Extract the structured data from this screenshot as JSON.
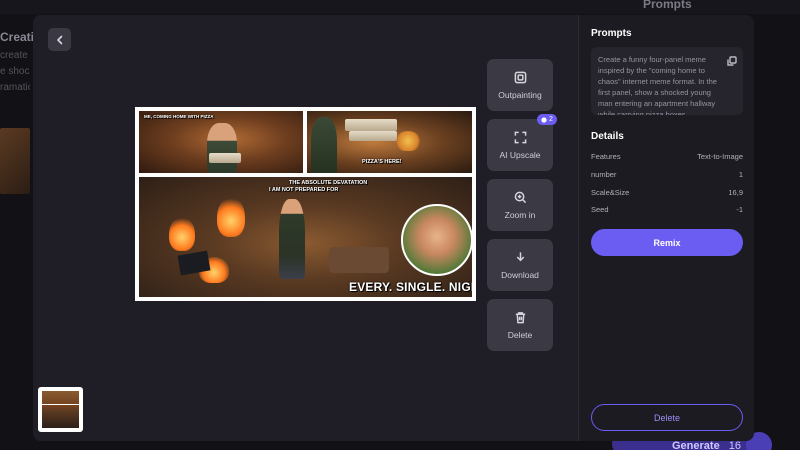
{
  "background": {
    "prompts_label": "Prompts",
    "left_title": "Creatio",
    "left_lines": [
      "create a",
      "e shock",
      "ramatic"
    ],
    "generate_label": "Generate",
    "generate_count": "16"
  },
  "viewer": {
    "meme": {
      "caption_panel1": "ME, COMING HOME WITH PIZZA",
      "caption_panel2": "PIZZA'S HERE!",
      "caption_panel3_line1": "THE ABSOLUTE DEVATATION",
      "caption_panel3_line2": "I AM NOT PREPARED FOR",
      "caption_big": "EVERY. SINGLE. NIGHT"
    },
    "actions": [
      {
        "label": "Outpainting",
        "icon": "outpainting-icon"
      },
      {
        "label": "AI Upscale",
        "icon": "upscale-icon",
        "badge": "2"
      },
      {
        "label": "Zoom in",
        "icon": "zoom-in-icon"
      },
      {
        "label": "Download",
        "icon": "download-icon"
      },
      {
        "label": "Delete",
        "icon": "trash-icon"
      }
    ]
  },
  "side_panel": {
    "prompts_title": "Prompts",
    "prompt_text": "Create a funny four-panel meme inspired by the \"coming home to chaos\" internet meme format. In the first panel, show a shocked young man entering an apartment hallway while carrying pizza boxes",
    "details_title": "Details",
    "details": [
      {
        "key": "Features",
        "value": "Text-to-Image"
      },
      {
        "key": "number",
        "value": "1"
      },
      {
        "key": "Scale&Size",
        "value": "16,9"
      },
      {
        "key": "Seed",
        "value": "-1"
      }
    ],
    "remix_label": "Remix",
    "delete_label": "Delete"
  },
  "colors": {
    "accent": "#6b5cf2",
    "modal_bg": "#222129",
    "button_bg": "#3b3a44"
  }
}
